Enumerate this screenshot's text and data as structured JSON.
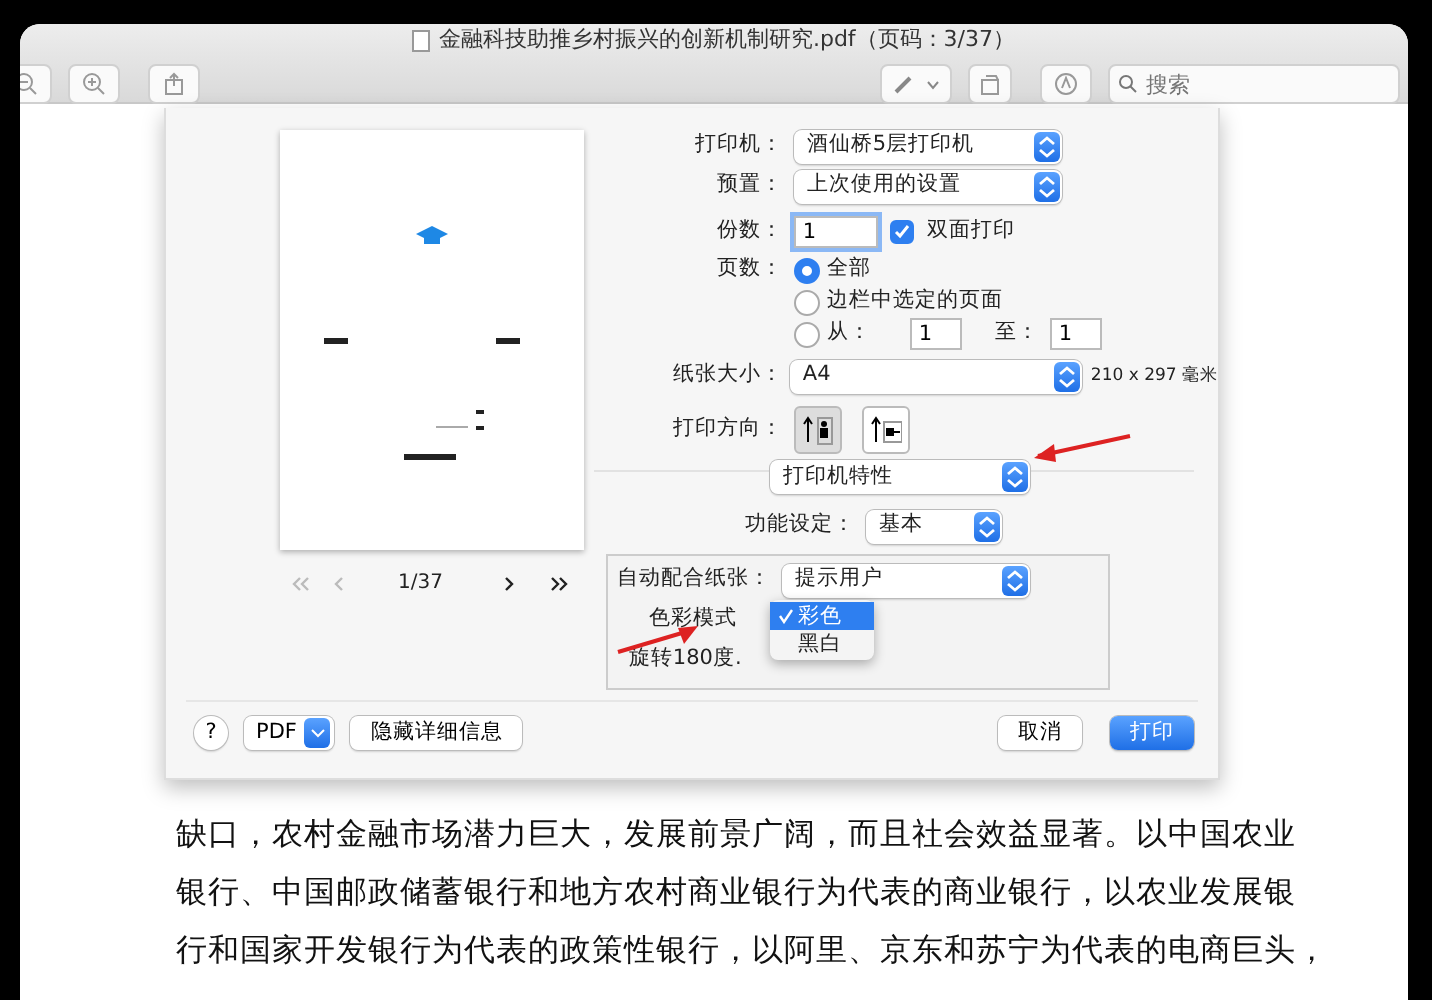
{
  "window": {
    "title": "金融科技助推乡村振兴的创新机制研究.pdf（页码：3/37）"
  },
  "toolbar": {
    "search": {
      "placeholder": "搜索"
    }
  },
  "print_dialog": {
    "preview": {
      "page_indicator": "1/37"
    },
    "printer": {
      "label": "打印机：",
      "value": "酒仙桥5层打印机"
    },
    "preset": {
      "label": "预置：",
      "value": "上次使用的设置"
    },
    "copies": {
      "label": "份数：",
      "value": "1"
    },
    "duplex": {
      "label": "双面打印",
      "checked": true
    },
    "pages": {
      "label": "页数：",
      "options": [
        {
          "label": "全部",
          "selected": true
        },
        {
          "label": "边栏中选定的页面",
          "selected": false
        },
        {
          "label": "从：",
          "selected": false
        }
      ],
      "to_label": "至：",
      "from_value": "1",
      "to_value": "1"
    },
    "paper_size": {
      "label": "纸张大小：",
      "value": "A4",
      "dimensions": "210 x 297 毫米"
    },
    "orientation": {
      "label": "打印方向：",
      "options": [
        {
          "kind": "portrait",
          "selected": true
        },
        {
          "kind": "landscape",
          "selected": false
        }
      ]
    },
    "section": {
      "value": "打印机特性"
    },
    "feature_set": {
      "label": "功能设定：",
      "value": "基本"
    },
    "auto_fit": {
      "label": "自动配合纸张：",
      "value": "提示用户"
    },
    "color_mode": {
      "label": "色彩模式",
      "menu": [
        {
          "label": "彩色",
          "selected": true
        },
        {
          "label": "黑白",
          "selected": false
        }
      ]
    },
    "rotate": {
      "label": "旋转180度."
    },
    "buttons": {
      "help": "?",
      "pdf": "PDF",
      "details": "隐藏详细信息",
      "cancel": "取消",
      "print": "打印"
    }
  },
  "body_text": [
    "缺口，农村金融市场潜力巨大，发展前景广阔，而且社会效益显著。以中国农业",
    "银行、中国邮政储蓄银行和地方农村商业银行为代表的商业银行，以农业发展银",
    "行和国家开发银行为代表的政策性银行，以阿里、京东和苏宁为代表的电商巨头，"
  ]
}
